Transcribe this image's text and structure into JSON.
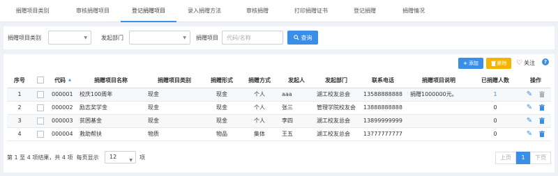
{
  "tabs": [
    {
      "label": "捐赠项目类别",
      "active": false
    },
    {
      "label": "审核捐赠项目",
      "active": false
    },
    {
      "label": "登记捐赠项目",
      "active": true
    },
    {
      "label": "录入捐赠方法",
      "active": false
    },
    {
      "label": "审核捐赠",
      "active": false
    },
    {
      "label": "打印捐赠证书",
      "active": false
    },
    {
      "label": "登记捐赠",
      "active": false
    },
    {
      "label": "捐赠情况",
      "active": false
    }
  ],
  "filter": {
    "category_label": "捐赠项目类别",
    "category_value": "",
    "dept_label": "发起部门",
    "dept_value": "",
    "project_label": "捐赠项目",
    "project_placeholder": "代码/名称",
    "query_label": "查询"
  },
  "toolbar": {
    "add_label": "添加",
    "delete_label": "删除",
    "follow_label": "关注",
    "help_label": "?"
  },
  "table": {
    "headers": [
      "序号",
      "",
      "代码",
      "捐赠项目名称",
      "捐赠项目类别",
      "捐赠形式",
      "捐赠方式",
      "发起人",
      "发起部门",
      "联系电话",
      "捐赠项目说明",
      "已捐赠人数",
      "操作"
    ],
    "rows": [
      {
        "no": "1",
        "code": "000001",
        "name": "校庆100周年",
        "category": "现金",
        "form": "现金",
        "method": "个人",
        "initiator": "aaa",
        "dept": "湖工校友总会",
        "phone": "13588888888",
        "desc": "捐赠1000000元。",
        "count": "1"
      },
      {
        "no": "2",
        "code": "000002",
        "name": "励志奖学金",
        "category": "现金",
        "form": "现金",
        "method": "个人",
        "initiator": "张三",
        "dept": "管理学院校友会",
        "phone": "13888888888",
        "desc": "",
        "count": "0"
      },
      {
        "no": "3",
        "code": "000003",
        "name": "贫困基金",
        "category": "现金",
        "form": "现金",
        "method": "个人",
        "initiator": "李四",
        "dept": "湖工校友总会",
        "phone": "13899999999",
        "desc": "",
        "count": "0"
      },
      {
        "no": "4",
        "code": "000004",
        "name": "救助帮扶",
        "category": "物质",
        "form": "物品",
        "method": "集体",
        "initiator": "王五",
        "dept": "湖工校友总会",
        "phone": "13777777777",
        "desc": "",
        "count": "0"
      }
    ]
  },
  "footer": {
    "summary": "第 1 至 4 项结果，共 4 项",
    "per_page_label": "每页显示",
    "per_page_value": "12",
    "per_page_suffix": "项",
    "prev_label": "上页",
    "current_page": "1",
    "next_label": "下页"
  },
  "colors": {
    "accent": "#3a8ee6",
    "warning": "#f4b400"
  }
}
